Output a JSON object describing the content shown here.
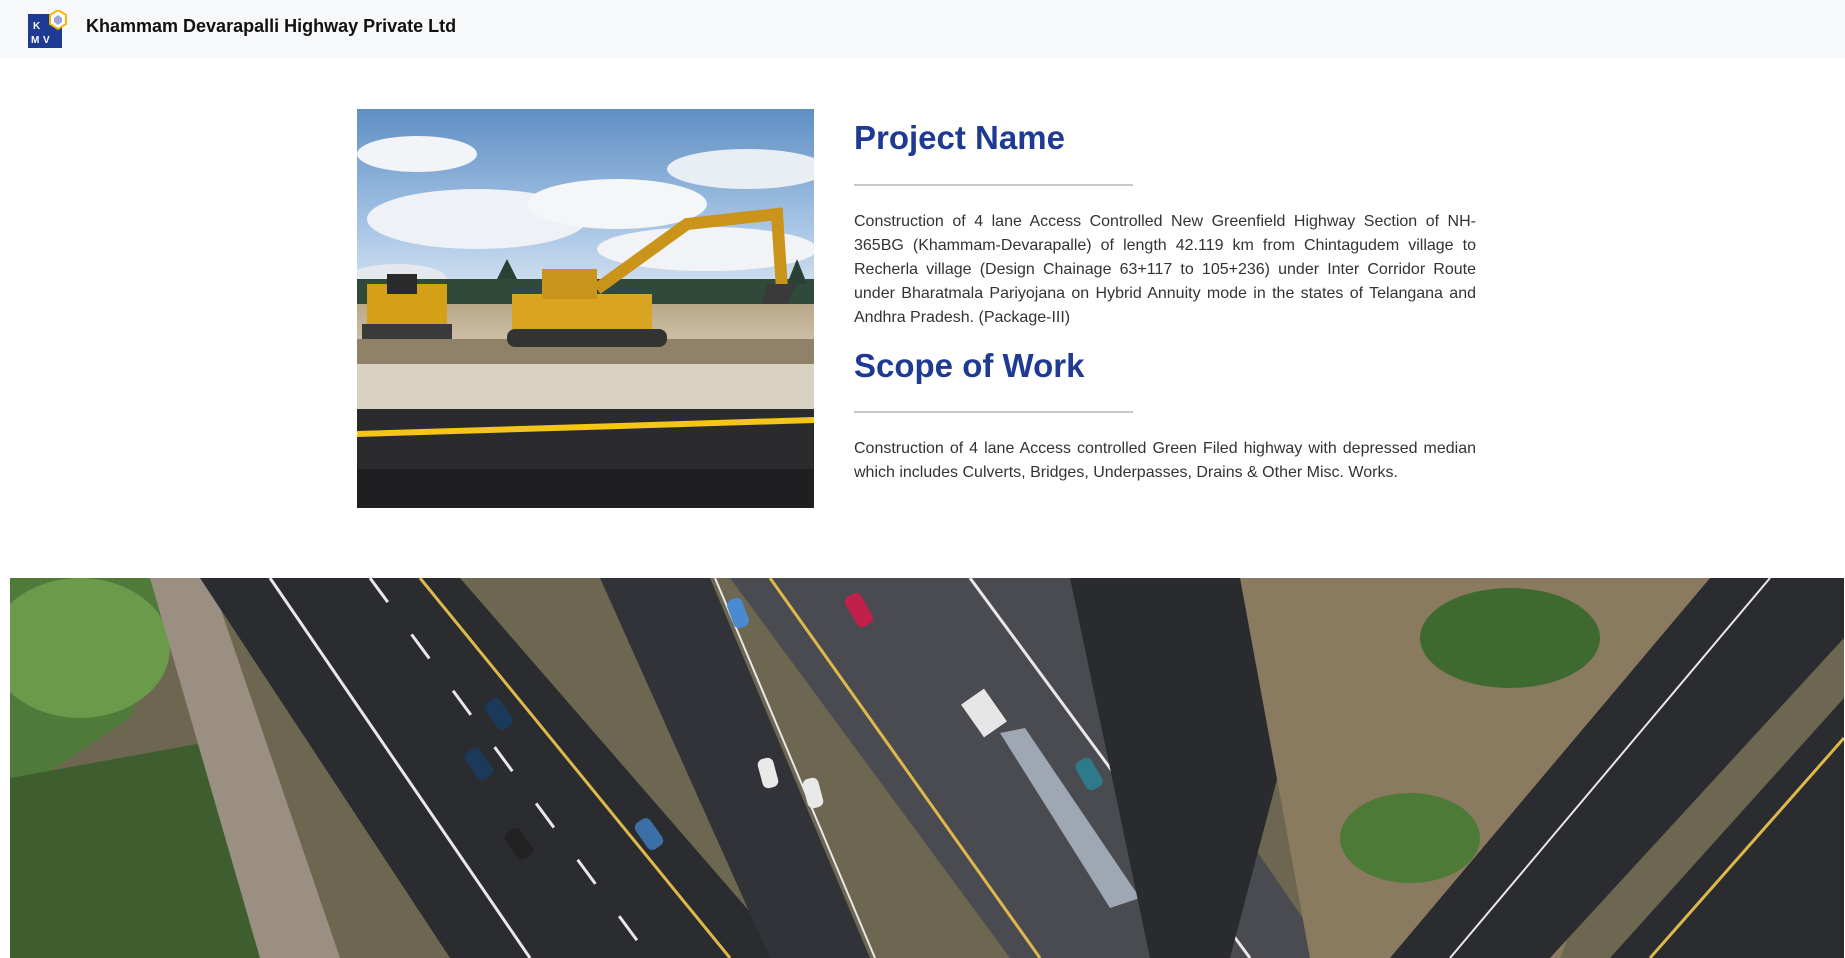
{
  "header": {
    "logo_text": "KMV",
    "title": "Khammam Devarapalli Highway Private Ltd",
    "logo_colors": {
      "primary": "#1f3a93",
      "accent": "#f2b705"
    }
  },
  "project": {
    "image_description_icon": "construction-photo",
    "name_heading": "Project Name",
    "name_text": "Construction of 4 lane Access Controlled New Greenfield Highway Section of NH-365BG (Khammam-Devarapalle) of length 42.119 km from Chintagudem village to Recherla village (Design Chainage 63+117 to 105+236) under Inter Corridor Route under Bharatmala Pariyojana on Hybrid Annuity mode in the states of Telangana and Andhra Pradesh. (Package-III)",
    "scope_heading": "Scope of Work",
    "scope_text": "Construction of 4 lane Access controlled Green Filed highway with depressed median which includes Culverts, Bridges, Underpasses, Drains & Other Misc. Works."
  },
  "colors": {
    "heading": "#1f3a93",
    "body_text": "#333333",
    "navbar_bg": "#f7f8fa"
  }
}
